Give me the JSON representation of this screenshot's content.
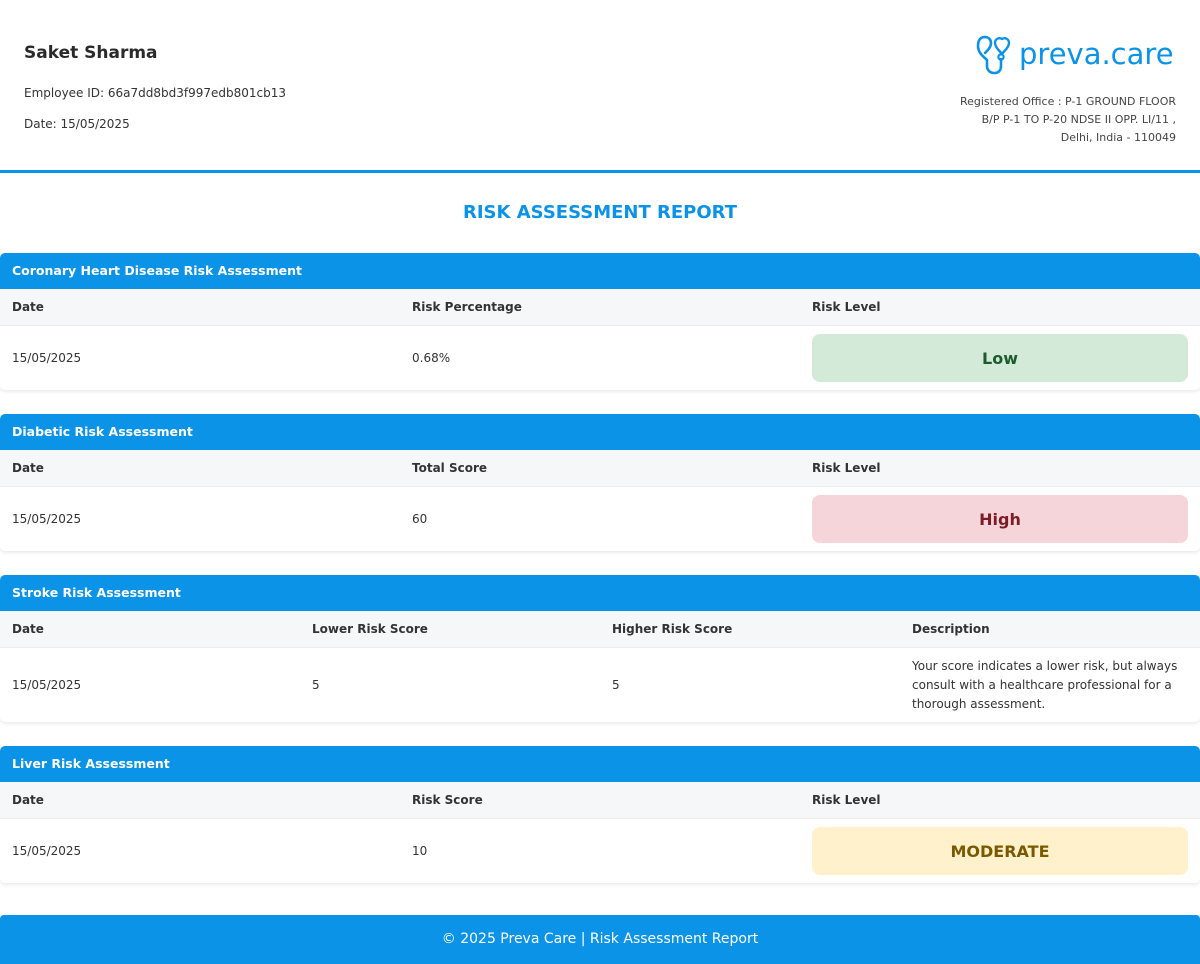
{
  "employee": {
    "name": "Saket Sharma",
    "id_line": "Employee ID: 66a7dd8bd3f997edb801cb13",
    "date_line": "Date: 15/05/2025"
  },
  "brand": {
    "logo_text": "preva.care",
    "logo_icon": "stethoscope-heart-icon",
    "accent_color": "#0b93e8",
    "office_lines": [
      "Registered Office : P-1 GROUND FLOOR",
      "B/P P-1 TO P-20 NDSE II OPP. LI/11 ,",
      "Delhi, India - 110049"
    ]
  },
  "report_title": "RISK ASSESSMENT REPORT",
  "chd": {
    "title": "Coronary Heart Disease Risk Assessment",
    "headers": [
      "Date",
      "Risk Percentage",
      "Risk Level"
    ],
    "row": {
      "date": "15/05/2025",
      "value": "0.68%",
      "level": "Low"
    },
    "level_colors": {
      "bg": "#d4ead9",
      "fg": "#1d5a2c"
    }
  },
  "diabetic": {
    "title": "Diabetic Risk Assessment",
    "headers": [
      "Date",
      "Total Score",
      "Risk Level"
    ],
    "row": {
      "date": "15/05/2025",
      "value": "60",
      "level": "High"
    },
    "level_colors": {
      "bg": "#f6d5da",
      "fg": "#7a1d26"
    }
  },
  "stroke": {
    "title": "Stroke Risk Assessment",
    "headers": [
      "Date",
      "Lower Risk Score",
      "Higher Risk Score",
      "Description"
    ],
    "row": {
      "date": "15/05/2025",
      "lower": "5",
      "higher": "5",
      "description": "Your score indicates a lower risk, but always consult with a healthcare professional for a thorough assessment."
    }
  },
  "liver": {
    "title": "Liver Risk Assessment",
    "headers": [
      "Date",
      "Risk Score",
      "Risk Level"
    ],
    "row": {
      "date": "15/05/2025",
      "value": "10",
      "level": "MODERATE"
    },
    "level_colors": {
      "bg": "#fff1cc",
      "fg": "#7a5a00"
    }
  },
  "footer": "© 2025 Preva Care | Risk Assessment Report"
}
